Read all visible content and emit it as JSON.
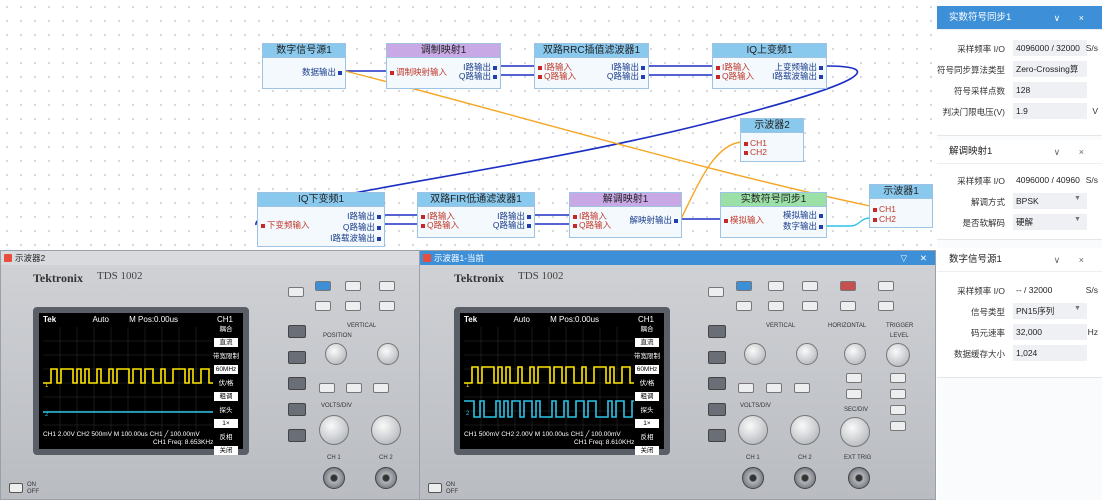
{
  "blocks": {
    "digital_source_1": {
      "title": "数字信号源1",
      "out": [
        "数据输出"
      ]
    },
    "mod_map_1": {
      "title": "调制映射1",
      "in": [
        "调制映射输入"
      ],
      "out": [
        "I路输出",
        "Q路输出"
      ]
    },
    "dual_rrc_1": {
      "title": "双路RRC插值滤波器1",
      "in": [
        "I路输入",
        "Q路输入"
      ],
      "out": [
        "I路输出",
        "Q路输出"
      ]
    },
    "iq_up_1": {
      "title": "IQ上变频1",
      "in": [
        "I路输入",
        "Q路输入"
      ],
      "out": [
        "上变频输出",
        "I路载波输出"
      ]
    },
    "scope_2": {
      "title": "示波器2",
      "in": [
        "CH1",
        "CH2"
      ]
    },
    "iq_down_1": {
      "title": "IQ下变频1",
      "in": [
        "下变频输入"
      ],
      "out": [
        "I路输出",
        "Q路输出",
        "I路载波输出"
      ]
    },
    "dual_fir_1": {
      "title": "双路FIR低通滤波器1",
      "in": [
        "I路输入",
        "Q路输入"
      ],
      "out": [
        "I路输出",
        "Q路输出"
      ]
    },
    "demod_map_1": {
      "title": "解调映射1",
      "in": [
        "I路输入",
        "Q路输入"
      ],
      "out": [
        "解映射输出"
      ]
    },
    "real_sync_1": {
      "title": "实数符号同步1",
      "in": [
        "模拟输入"
      ],
      "out": [
        "模拟输出",
        "数字输出"
      ]
    },
    "scope_1": {
      "title": "示波器1",
      "in": [
        "CH1",
        "CH2"
      ]
    }
  },
  "colors": {
    "wire_blue": "#1b2fc4",
    "wire_orange": "#f5a623",
    "wire_cyan": "#2bc4e8",
    "accent": "#3d8fd8"
  },
  "panel": {
    "sections": [
      {
        "title": "实数符号同步1",
        "active": true,
        "ctrl": "∨ ×",
        "rows": [
          {
            "label": "采样频率 I/O",
            "value": "4096000 / 32000",
            "unit": "S/s"
          },
          {
            "label": "符号同步算法类型",
            "value": "Zero-Crossing算",
            "unit": ""
          },
          {
            "label": "符号采样点数",
            "value": "128",
            "unit": ""
          },
          {
            "label": "判决门限电压(V)",
            "value": "1.9",
            "unit": "V"
          }
        ]
      },
      {
        "title": "解调映射1",
        "active": false,
        "ctrl": "∨ ×",
        "rows": [
          {
            "label": "采样频率 I/O",
            "value": "4096000 / 40960",
            "unit": "S/s"
          },
          {
            "label": "解调方式",
            "value": "BPSK",
            "unit": "",
            "dropdown": true
          },
          {
            "label": "是否软解码",
            "value": "硬解",
            "unit": "",
            "dropdown": true
          }
        ]
      },
      {
        "title": "数字信号源1",
        "active": false,
        "ctrl": "∨ ×",
        "rows": [
          {
            "label": "采样频率 I/O",
            "value": "-- / 32000",
            "unit": "S/s"
          },
          {
            "label": "信号类型",
            "value": "PN15序列",
            "unit": "",
            "dropdown": true
          },
          {
            "label": "码元速率",
            "value": "32,000",
            "unit": "Hz"
          },
          {
            "label": "数据缓存大小",
            "value": "1,024",
            "unit": ""
          }
        ]
      }
    ]
  },
  "scopes": [
    {
      "window_title": "示波器2",
      "brand": "Tektronix",
      "model": "TDS 1002",
      "status_left": "Tek",
      "status_mid": "Auto",
      "status_pos": "M Pos:0.00us",
      "status_ch": "CH1",
      "menu": [
        "耦合",
        "直流",
        "带宽限制",
        "60MHz",
        "伏/格",
        "粗调",
        "探头",
        "1×",
        "反相",
        "关闭"
      ],
      "bottom_line1": "CH1 2.00V    CH2 500mV    M 100.00us    CH1 ╱ 100.00mV",
      "bottom_line2": "CH1 Freq: 8.653KHz",
      "power_on": "ON",
      "power_off": "OFF"
    },
    {
      "window_title": "示波器1-当前",
      "brand": "Tektronix",
      "model": "TDS 1002",
      "status_left": "Tek",
      "status_mid": "Auto",
      "status_pos": "M Pos:0.00us",
      "status_ch": "CH1",
      "menu": [
        "耦合",
        "直流",
        "带宽限制",
        "60MHz",
        "伏/格",
        "粗调",
        "探头",
        "1×",
        "反相",
        "关闭"
      ],
      "bottom_line1": "CH1 500mV    CH2 2.00V    M 100.00us    CH1 ╱ 100.00mV",
      "bottom_line2": "CH1 Freq: 8.610KHz",
      "power_on": "ON",
      "power_off": "OFF"
    }
  ],
  "scope_panel_labels": {
    "vertical": "VERTICAL",
    "horizontal": "HORIZONTAL",
    "trigger": "TRIGGER",
    "position": "POSITION",
    "volts_div": "VOLTS/DIV",
    "sec_div": "SEC/DIV",
    "level": "LEVEL",
    "ch1": "CH 1",
    "ch2": "CH 2",
    "ext_trig": "EXT TRIG"
  }
}
